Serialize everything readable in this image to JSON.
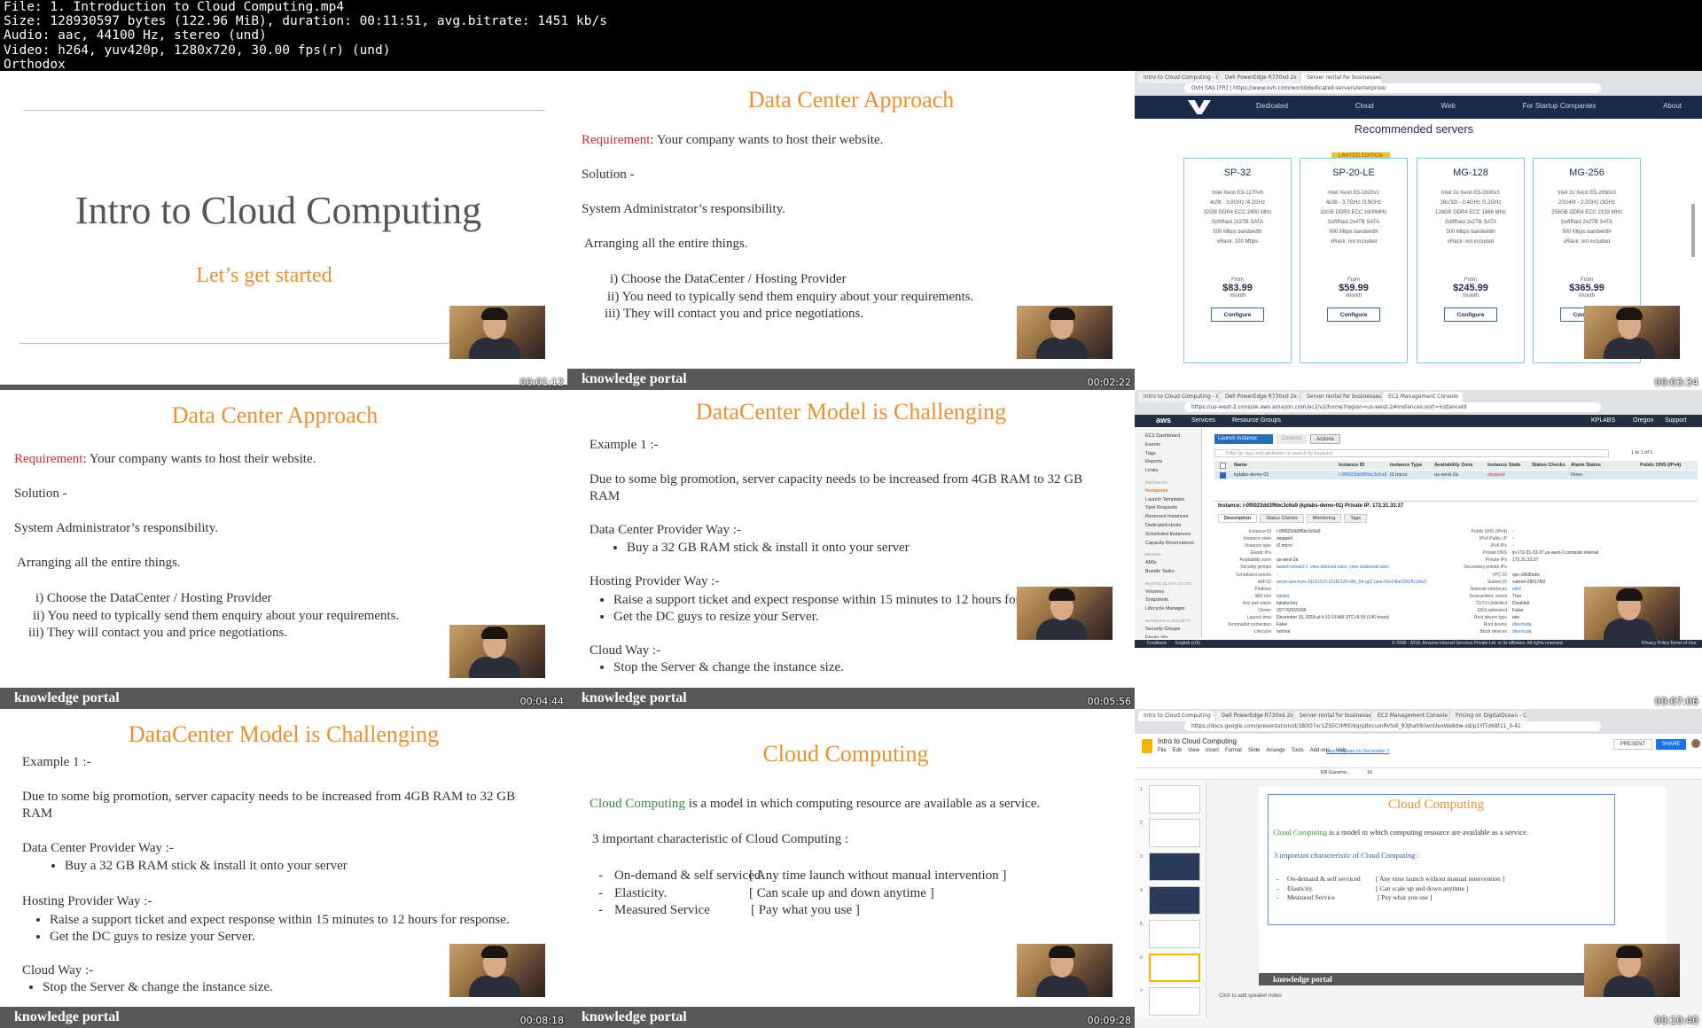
{
  "header": {
    "lines": [
      "File: 1. Introduction to Cloud Computing.mp4",
      "Size: 128930597 bytes (122.96 MiB), duration: 00:11:51, avg.bitrate: 1451 kb/s",
      "Audio: aac, 44100 Hz, stereo (und)",
      "Video: h264, yuv420p, 1280x720, 30.00 fps(r) (und)",
      "Orthodox"
    ]
  },
  "brand_footer": "knowledge portal",
  "colors": {
    "orange": "#e8912e",
    "red": "#d22b2b",
    "green": "#3a8a3a",
    "blue": "#2a5ab0",
    "footer": "#595959"
  },
  "tiles": {
    "t1": {
      "timestamp": "00:01:12",
      "title": "Intro to Cloud Computing",
      "subtitle": "Let’s get started"
    },
    "t2": {
      "timestamp": "00:02:22",
      "title": "Data Center Approach",
      "req_label": "Requirement",
      "req_text": ":  Your company wants to host their website.",
      "solution": "Solution -",
      "sysadmin": "System Administrator’s responsibility.",
      "arranging": "Arranging all the entire things.",
      "steps": [
        "i)  Choose the DataCenter / Hosting Provider",
        "ii)  You need to typically send them enquiry about your requirements.",
        "iii)  They will contact you and price negotiations."
      ]
    },
    "t3": {
      "timestamp": "00:03:34",
      "tabs": [
        "Intro to Cloud Computing - Goo",
        "Dell PowerEdge R730xd 2x - 12",
        "Server rental for businesses | O"
      ],
      "url": "OVH SAS [FR]  |  https://www.ovh.com/world/dedicated-servers/enterprise/",
      "nav": [
        "Dedicated",
        "Cloud",
        "Web",
        "For Startup Companies",
        "About"
      ],
      "heading": "Recommended servers",
      "badge": "LIMITED EDITION",
      "cards": [
        {
          "name": "SP-32",
          "specs": [
            "Intel Xeon E3-1270v6",
            "4c/8t - 3.8GHz /4.2GHz",
            "32GB DDR4 ECC 2400 MHz",
            "SoftRaid 2x2TB SATA",
            "500 Mbps bandwidth",
            "vRack: 100 Mbps"
          ],
          "from": "From",
          "price": "$83.99",
          "per": "/month",
          "btn": "Configure"
        },
        {
          "name": "SP-20-LE",
          "specs": [
            "Intel Xeon E5-1620v2",
            "4c/8t - 3.7GHz /3.9GHz",
            "32GB DDR3 ECC 1600MHz",
            "SoftRaid 2x4TB SATA",
            "500 Mbps bandwidth",
            "vRack: not included"
          ],
          "from": "From",
          "price": "$59.99",
          "per": "/month",
          "btn": "Configure"
        },
        {
          "name": "MG-128",
          "specs": [
            "Intel 2x Xeon E5-2630v3",
            "16c/32t - 2.4GHz /3.2GHz",
            "128GB DDR4 ECC 1866 MHz",
            "SoftRaid 2x2TB SATA",
            "500 Mbps bandwidth",
            "vRack: not included"
          ],
          "from": "From",
          "price": "$245.99",
          "per": "/month",
          "btn": "Configure"
        },
        {
          "name": "MG-256",
          "specs": [
            "Intel 2x Xeon E5-2650v3",
            "20c/40t - 2.3GHz /3GHz",
            "256GB DDR4 ECC 2133 MHz",
            "SoftRaid 2x2TB SATA",
            "500 Mbps bandwidth",
            "vRack: not included"
          ],
          "from": "From",
          "price": "$365.99",
          "per": "/month",
          "btn": "Configure"
        }
      ]
    },
    "t4": {
      "timestamp": "00:04:44",
      "title": "Data Center Approach",
      "req_label": "Requirement",
      "req_text": ":  Your company wants to host their website.",
      "solution": "Solution -",
      "sysadmin": "System Administrator’s responsibility.",
      "arranging": "Arranging all the entire things.",
      "steps": [
        "i)  Choose the DataCenter / Hosting Provider",
        "ii)  You need to typically send them enquiry about your requirements.",
        "iii)  They will contact you and price negotiations."
      ]
    },
    "t5": {
      "timestamp": "00:05:56",
      "title": "DataCenter Model is Challenging",
      "example": "Example 1 :-",
      "desc": "Due to some big promotion, server capacity needs to be increased from 4GB RAM to 32 GB RAM",
      "dc_label": "Data Center  Provider Way :-",
      "dc_items": [
        "Buy a 32 GB RAM stick & install it onto your server"
      ],
      "hp_label": "Hosting Provider Way :-",
      "hp_items": [
        "Raise a support ticket and expect response within 15 minutes to 12 hours for response.",
        "Get the DC guys to resize your Server."
      ],
      "cloud_label": "Cloud Way :-",
      "cloud_items": [
        "Stop the Server & change the instance size."
      ]
    },
    "t6": {
      "timestamp": "00:07:06",
      "tabs": [
        "Intro to Cloud Computing - Goo",
        "Dell PowerEdge R730xd 2x - 12",
        "Server rental for businesses | O",
        "EC2 Management Console"
      ],
      "url": "https://us-west-2.console.aws.amazon.com/ec2/v2/home?region=us-west-2#Instances:sort=instanceId",
      "topnav": [
        "Services",
        "Resource Groups"
      ],
      "user": "KPLABS",
      "region": "Oregon",
      "support": "Support",
      "sidebar": [
        "EC2 Dashboard",
        "Events",
        "Tags",
        "Reports",
        "Limits",
        "INSTANCES",
        "Instances",
        "Launch Templates",
        "Spot Requests",
        "Reserved Instances",
        "Dedicated Hosts",
        "Scheduled Instances",
        "Capacity Reservations",
        "IMAGES",
        "AMIs",
        "Bundle Tasks",
        "ELASTIC BLOCK STORE",
        "Volumes",
        "Snapshots",
        "Lifecycle Manager",
        "NETWORK & SECURITY",
        "Security Groups",
        "Elastic IPs"
      ],
      "launch": "Launch Instance",
      "connect": "Connect",
      "actions": "Actions",
      "filter": "Filter by tags and attributes or search by keyword",
      "paging": "1 to 1 of 1",
      "columns": [
        "Name",
        "Instance ID",
        "Instance Type",
        "Availability Zone",
        "Instance State",
        "Status Checks",
        "Alarm Status",
        "Public DNS (IPv4)"
      ],
      "row": [
        "kplabs-demo-01",
        "i-0f0023dd3f6bc3c6a9",
        "t2.micro",
        "us-west-2a",
        "stopped",
        "",
        "None",
        ""
      ],
      "detail_title": "Instance: i-0f0023dd3f6bc3c6a9 (kplabs-demo-01)      Private IP: 172.31.33.37",
      "detail_tabs": [
        "Description",
        "Status Checks",
        "Monitoring",
        "Tags"
      ],
      "left_fields": [
        [
          "Instance ID",
          "i-0f0023dd3f6bc3c6a9"
        ],
        [
          "Instance state",
          "stopped"
        ],
        [
          "Instance type",
          "t2.micro"
        ],
        [
          "Elastic IPs",
          ""
        ],
        [
          "Availability zone",
          "us-west-2a"
        ],
        [
          "Security groups",
          "launch-wizard-1. view inbound rules. view outbound rules"
        ],
        [
          "Scheduled events",
          "-"
        ],
        [
          "AMI ID",
          "amzn-ami-hvm-2018.03.0.20181129-x86_64-gp2 (ami-01e24be29428c15b2)"
        ],
        [
          "Platform",
          "-"
        ],
        [
          "IAM role",
          "kplabs"
        ],
        [
          "Key pair name",
          "kplabs-key"
        ],
        [
          "Owner",
          "207742915106"
        ],
        [
          "Launch time",
          "December 16, 2018 at 6:12:13 AM UTC+5:30 (146 hours)"
        ],
        [
          "Termination protection",
          "False"
        ],
        [
          "Lifecycle",
          "normal"
        ]
      ],
      "right_fields": [
        [
          "Public DNS (IPv4)",
          "-"
        ],
        [
          "IPv4 Public IP",
          "-"
        ],
        [
          "IPv6 IPs",
          "-"
        ],
        [
          "Private DNS",
          "ip-172-31-33-37.us-west-2.compute.internal"
        ],
        [
          "Private IPs",
          "172.31.33.37"
        ],
        [
          "Secondary private IPs",
          ""
        ],
        [
          "VPC ID",
          "vpc-c86d5ebc"
        ],
        [
          "Subnet ID",
          "subnet-28617f82"
        ],
        [
          "Network interfaces",
          "eth0"
        ],
        [
          "Source/dest. check",
          "True"
        ],
        [
          "T2/T3 Unlimited",
          "Disabled"
        ],
        [
          "EBS-optimized",
          "False"
        ],
        [
          "Root device type",
          "ebs"
        ],
        [
          "Root device",
          "/dev/xvda"
        ],
        [
          "Block devices",
          "/dev/xvda"
        ]
      ],
      "footer_left": [
        "Feedback",
        "English (US)"
      ],
      "footer_mid": "© 2008 - 2018, Amazon Internet Services Private Ltd. or its affiliates. All rights reserved.",
      "footer_right": [
        "Privacy Policy",
        "Terms of Use"
      ]
    },
    "t7": {
      "timestamp": "00:08:18",
      "title": "DataCenter Model is Challenging",
      "example": "Example 1 :-",
      "desc": "Due to some big promotion, server capacity needs to be increased from 4GB RAM to 32 GB RAM",
      "dc_label": "Data Center  Provider Way :-",
      "dc_items": [
        "Buy a 32 GB RAM stick & install it onto your server"
      ],
      "hp_label": "Hosting Provider Way :-",
      "hp_items": [
        "Raise a support ticket and expect response within 15 minutes to 12 hours for response.",
        "Get the DC guys to resize your Server."
      ],
      "cloud_label": "Cloud Way :-",
      "cloud_items": [
        "Stop the Server & change the instance size."
      ]
    },
    "t8": {
      "timestamp": "00:09:28",
      "title": "Cloud Computing",
      "def_term": "Cloud Computing",
      "def_rest": " is a model in which computing resource are available as a service.",
      "char_heading": "3 important characteristic of Cloud Computing :",
      "chars": [
        [
          "On-demand & self serviced",
          "[ Any time launch without manual intervention ]"
        ],
        [
          "Elasticity.",
          "[ Can scale up and down anytime ]"
        ],
        [
          "Measured Service",
          "[ Pay what you use ]"
        ]
      ]
    },
    "t9": {
      "timestamp": "00:10:40",
      "tabs": [
        "Intro to Cloud Computing - Goo",
        "Dell PowerEdge R730xd 2x - 12",
        "Server rental for businesses | O",
        "EC2 Management Console",
        "Pricing on DigitalOcean - Clou"
      ],
      "url": "https://docs.google.com/presentation/d/1B0O7xr1ZSECrMtEI9qrpBocumRVSdl_93Jha0lklwnUeoWe8dw-sd/p1YlTd68t11_ll-41",
      "doc_title": "Intro to Cloud Computing",
      "menu": [
        "File",
        "Edit",
        "View",
        "Insert",
        "Format",
        "Slide",
        "Arrange",
        "Tools",
        "Add-ons",
        "Help"
      ],
      "last_edit": "Last edit was on December 7",
      "present": "PRESENT",
      "share": "SHARE",
      "font": "EB Garamo...",
      "size": "16",
      "thumbs": [
        "1",
        "2",
        "3",
        "4",
        "5",
        "6",
        "7"
      ],
      "slide_title": "Cloud Computing",
      "def_term": "Cloud Computing",
      "def_rest": " is a model in which computing resource are available as a service.",
      "char_heading": "3 important characteristic of Cloud Computing :",
      "chars": [
        [
          "On-demand & self serviced",
          "[ Any time launch without manual intervention ]"
        ],
        [
          "Elasticity.",
          "[ Can scale up and down anytime ]"
        ],
        [
          "Measured Service",
          "[ Pay what you use ]"
        ]
      ],
      "notes": "Click to add speaker notes"
    }
  }
}
